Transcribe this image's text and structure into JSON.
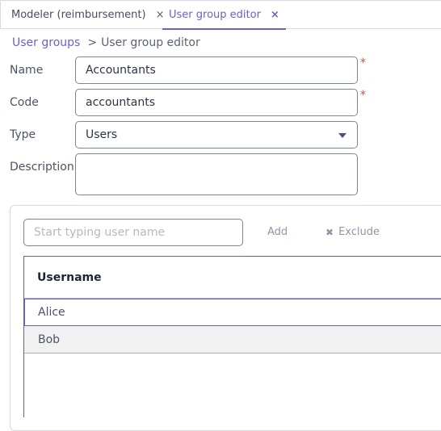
{
  "tabs": [
    {
      "label": "Modeler (reimbursement)",
      "close": "×",
      "active": false
    },
    {
      "label": "User group editor",
      "close": "×",
      "active": true
    }
  ],
  "breadcrumb": {
    "parent": "User groups",
    "separator": ">",
    "current": "User group editor"
  },
  "form": {
    "name": {
      "label": "Name",
      "value": "Accountants",
      "required": "*"
    },
    "code": {
      "label": "Code",
      "value": "accountants",
      "required": "*"
    },
    "type": {
      "label": "Type",
      "value": "Users"
    },
    "description": {
      "label": "Description",
      "value": ""
    }
  },
  "members": {
    "search_placeholder": "Start typing user name",
    "add_label": "Add",
    "exclude_label": "Exclude",
    "exclude_icon": "✖",
    "column_header": "Username",
    "rows": [
      "Alice",
      "Bob"
    ]
  },
  "colors": {
    "accent": "#6b5fc9",
    "required": "#e8463c",
    "border": "#7c8498"
  }
}
